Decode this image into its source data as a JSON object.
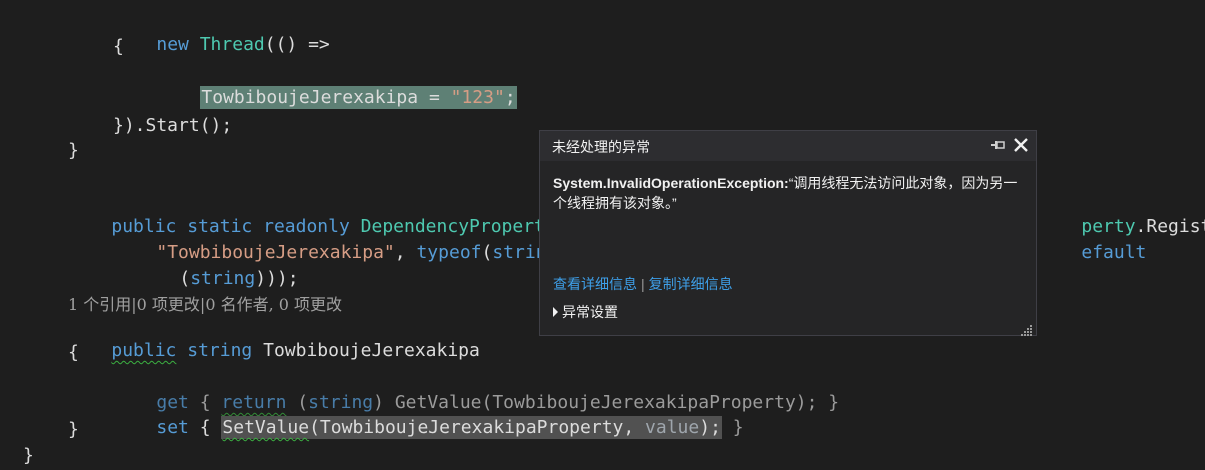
{
  "code": {
    "l1": {
      "kw": "new",
      "type": "Thread",
      "rest": "(() =>"
    },
    "l2": "{",
    "l3": {
      "field": "TowbiboujeJerexakipa",
      "eq": " = ",
      "str": "\"123\"",
      "semi": ";"
    },
    "l4": "}).Start();",
    "l5": "}",
    "l6": {
      "kw1": "public",
      "kw2": "static",
      "kw3": "readonly",
      "type": "DependencyProperty",
      "tail_type": "perty",
      "tail_rest": ".Register("
    },
    "l7": {
      "str": "\"TowbiboujeJerexakipa\"",
      "comma": ", ",
      "kw": "typeof",
      "open": "(",
      "kw2": "string",
      "close": ")",
      "tail": "efault"
    },
    "l8": {
      "open": "(",
      "kw": "string",
      "close": ")));"
    },
    "codelens": "1 个引用|0 项更改|0 名作者, 0 项更改",
    "l9": {
      "kw1": "public",
      "kw2": "string",
      "name": "TowbiboujeJerexakipa"
    },
    "l10": "{",
    "l11": {
      "kw1": "get",
      "b1": " { ",
      "kw2": "return",
      "sp": " (",
      "kw3": "string",
      "rest": ") GetValue(TowbiboujeJerexakipaProperty);",
      "b2": " }"
    },
    "l12": {
      "kw1": "set",
      "b1": " { ",
      "call": "SetValue",
      "args": "(TowbiboujeJerexakipaProperty, ",
      "param": "value",
      "end": ");",
      "b2": " }"
    },
    "l13": "}",
    "l14": "}"
  },
  "popup": {
    "title": "未经处理的异常",
    "exception_type": "System.InvalidOperationException:",
    "exception_message": "“调用线程无法访问此对象，因为另一个线程拥有该对象。”",
    "link_details": "查看详细信息",
    "link_copy": "复制详细信息",
    "link_separator": "|",
    "settings_label": "异常设置"
  }
}
